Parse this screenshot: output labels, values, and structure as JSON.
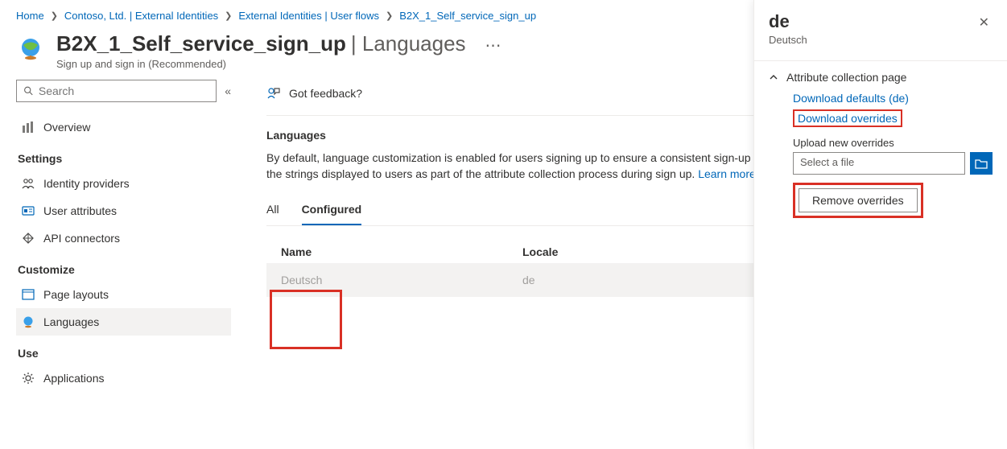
{
  "breadcrumb": {
    "home": "Home",
    "org": "Contoso, Ltd. | External Identities",
    "flows": "External Identities | User flows",
    "flow": "B2X_1_Self_service_sign_up"
  },
  "header": {
    "title": "B2X_1_Self_service_sign_up",
    "suffix": " | Languages",
    "desc": "Sign up and sign in (Recommended)"
  },
  "sidebar": {
    "search_placeholder": "Search",
    "overview": "Overview",
    "settings": "Settings",
    "idp": "Identity providers",
    "attrs": "User attributes",
    "api": "API connectors",
    "customize": "Customize",
    "layouts": "Page layouts",
    "languages": "Languages",
    "use": "Use",
    "applications": "Applications"
  },
  "main": {
    "feedback": "Got feedback?",
    "section": "Languages",
    "para_text": "By default, language customization is enabled for users signing up to ensure a consistent sign-up experience. You can use languages to modify the strings displayed to users as part of the attribute collection process during sign up. ",
    "para_link": "Learn more about language customization in user flows.",
    "tab_all": "All",
    "tab_conf": "Configured",
    "col_name": "Name",
    "col_locale": "Locale",
    "row_name": "Deutsch",
    "row_locale": "de"
  },
  "panel": {
    "title": "de",
    "subtitle": "Deutsch",
    "accordion": "Attribute collection page",
    "dl_defaults": "Download defaults (de)",
    "dl_overrides": "Download overrides",
    "upload_label": "Upload new overrides",
    "file_placeholder": "Select a file",
    "remove": "Remove overrides"
  }
}
